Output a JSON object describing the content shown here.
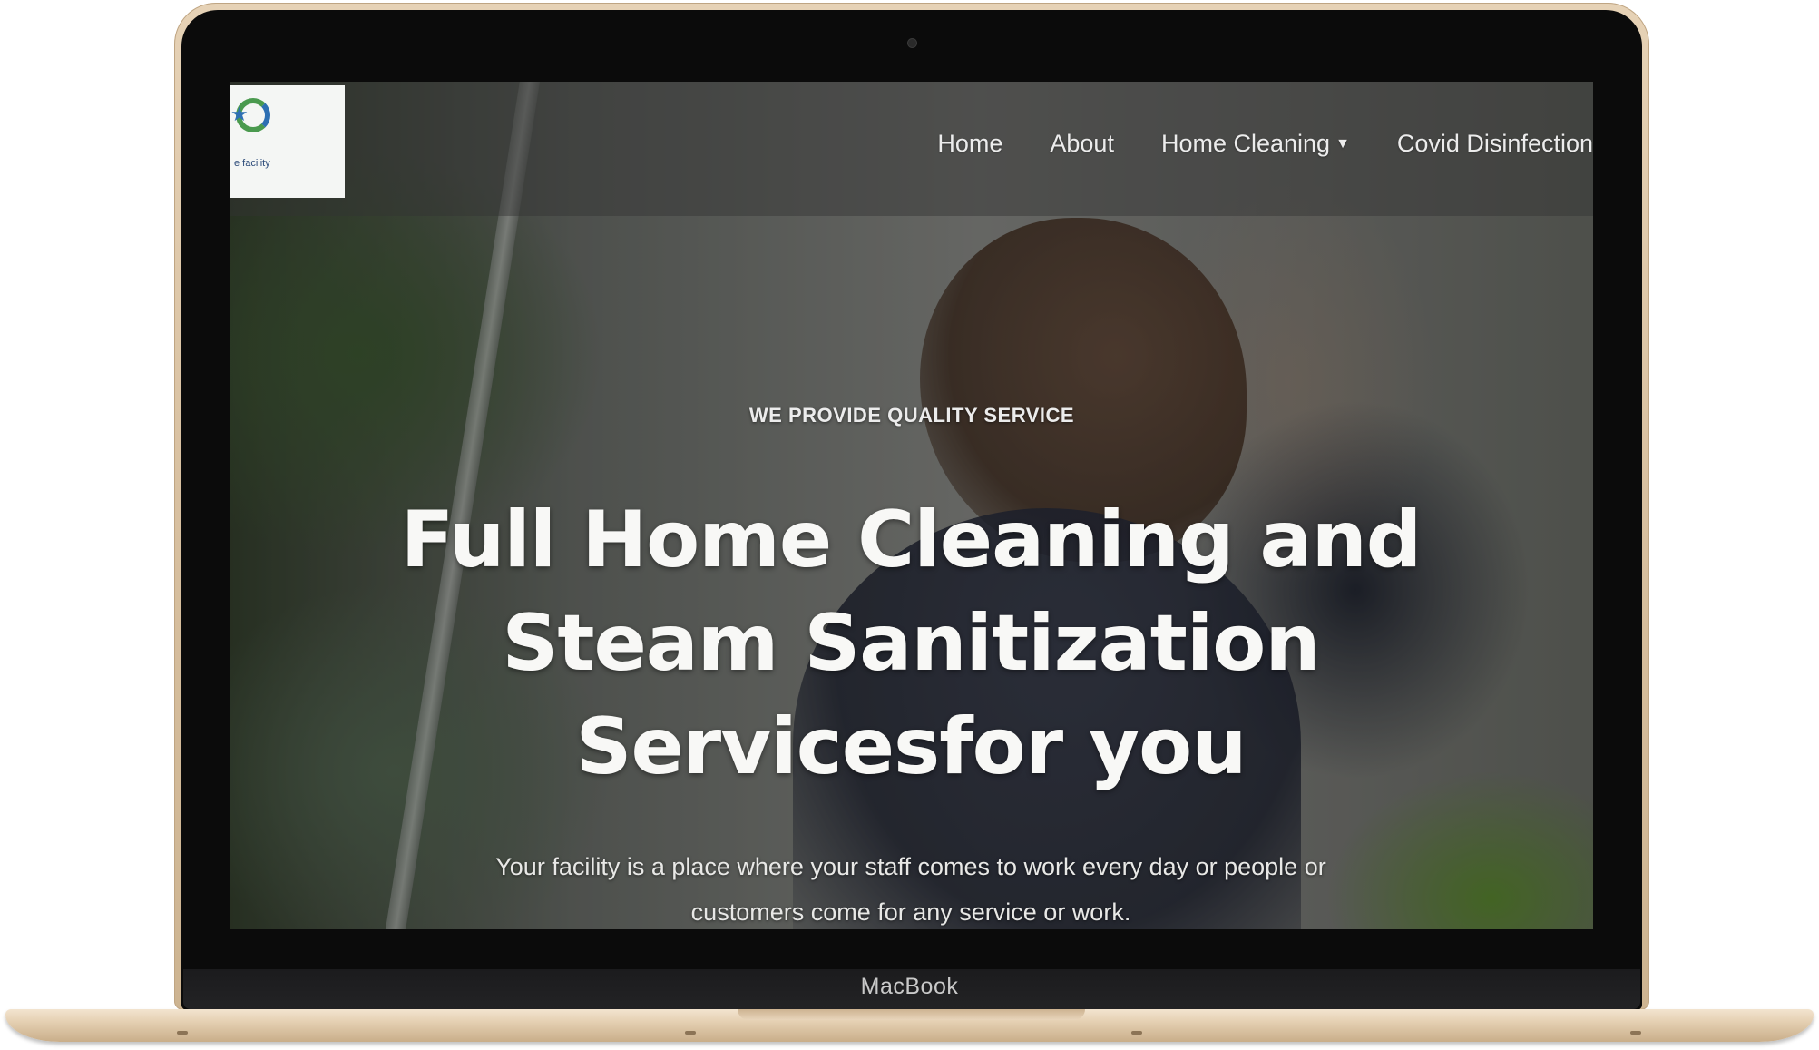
{
  "device": {
    "label": "MacBook"
  },
  "site": {
    "logo": {
      "icon": "house-star-logo-icon",
      "text": "e facility"
    },
    "nav": {
      "items": [
        {
          "label": "Home"
        },
        {
          "label": "About"
        },
        {
          "label": "Home Cleaning",
          "icon": "caret-down-icon"
        },
        {
          "label": "Covid Disinfection"
        }
      ]
    },
    "hero": {
      "eyebrow": "WE PROVIDE QUALITY SERVICE",
      "headline_lines": [
        "Full Home Cleaning and",
        "Steam Sanitization",
        "Servicesfor you"
      ],
      "subtext_lines": [
        "Your facility is a place where your staff comes to work every day or people or",
        "customers come for any service or work."
      ]
    }
  },
  "colors": {
    "frame_gold": "#d8c0a0",
    "bezel": "#0b0b0b",
    "nav_text": "#ececec",
    "logo_green": "#4a9a4e",
    "logo_blue": "#2d6fb3"
  }
}
